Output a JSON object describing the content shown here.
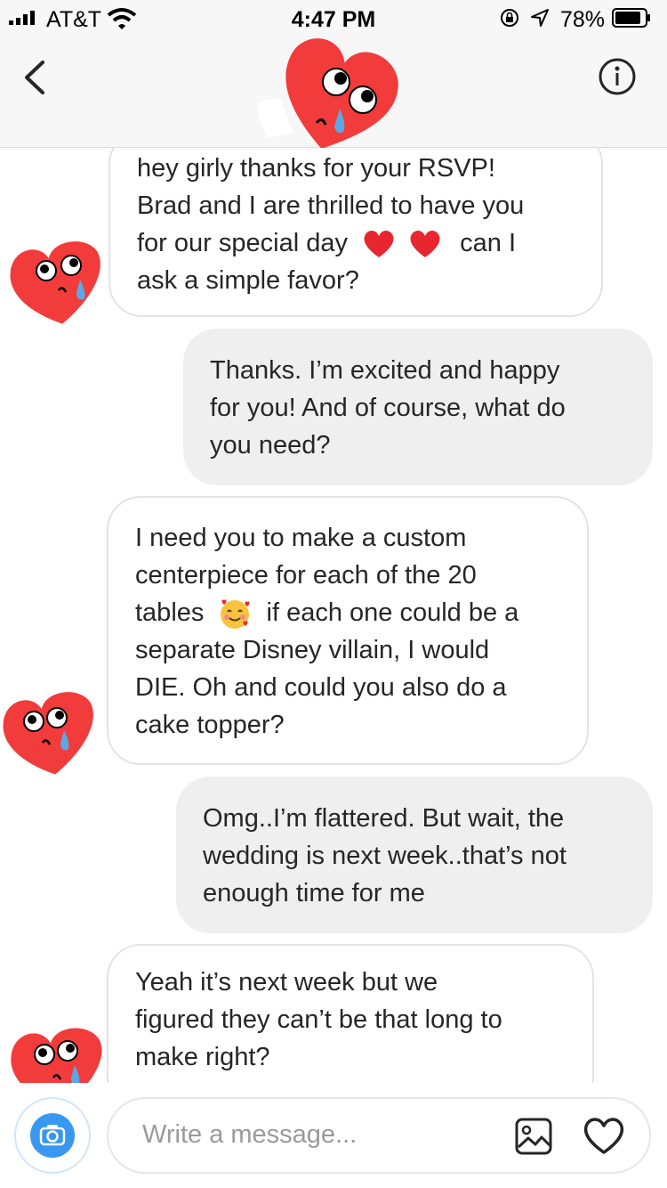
{
  "status_bar": {
    "carrier": "AT&T",
    "time": "4:47 PM",
    "battery": "78%"
  },
  "header": {
    "back_icon": "chevron-left-icon",
    "info_icon": "info-icon",
    "avatar": "crying-heart-emoji"
  },
  "messages": [
    {
      "direction": "incoming",
      "lines": [
        "hey girly thanks for your RSVP!",
        "Brad and I are thrilled to have you",
        "for our special day",
        "ask a simple favor?"
      ],
      "inline": {
        "hearts": "can I"
      }
    },
    {
      "direction": "outgoing",
      "lines": [
        "Thanks. I’m excited and happy",
        "for you! And of course, what do",
        "you need?"
      ]
    },
    {
      "direction": "incoming",
      "lines": [
        "I need you to make a custom",
        "centerpiece for each of the 20",
        "tables",
        "if each one could be a",
        "separate Disney villain, I would",
        "DIE. Oh and could you also do a",
        "cake topper?"
      ]
    },
    {
      "direction": "outgoing",
      "lines": [
        "Omg..I’m flattered. But wait, the",
        "wedding is next week..that’s not",
        "enough time for me"
      ]
    },
    {
      "direction": "incoming",
      "lines": [
        "Yeah it’s next week but we",
        "figured they can’t be that long to",
        "make right?"
      ]
    }
  ],
  "composer": {
    "placeholder": "Write a message...",
    "camera_icon": "camera-icon",
    "gallery_icon": "gallery-icon",
    "like_icon": "heart-outline-icon"
  },
  "colors": {
    "accent": "#3897f0",
    "outgoing_bubble": "#efefef",
    "heart_red": "#f23b3b",
    "tear_blue": "#5aa9e6"
  }
}
